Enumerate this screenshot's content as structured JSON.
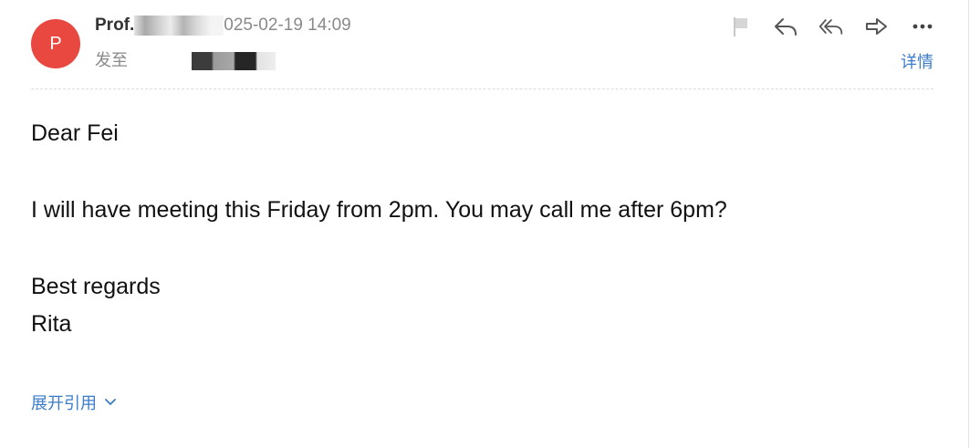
{
  "header": {
    "avatar_letter": "P",
    "avatar_color": "#e8483f",
    "sender_name": "Prof.",
    "date_time": "025-02-19 14:09",
    "to_label": "发至",
    "details_link": "详情"
  },
  "toolbar": {
    "icons": [
      "flag-icon",
      "reply-icon",
      "reply-all-icon",
      "forward-icon",
      "more-icon"
    ]
  },
  "message": {
    "greeting": "Dear Fei",
    "body": "I will have meeting this Friday from 2pm. You may call me after 6pm?",
    "closing": "Best regards",
    "signature": "Rita"
  },
  "quote": {
    "expand_label": "展开引用"
  },
  "colors": {
    "accent": "#3b7cc9",
    "muted_text": "#8a8a8a",
    "avatar": "#e8483f"
  }
}
